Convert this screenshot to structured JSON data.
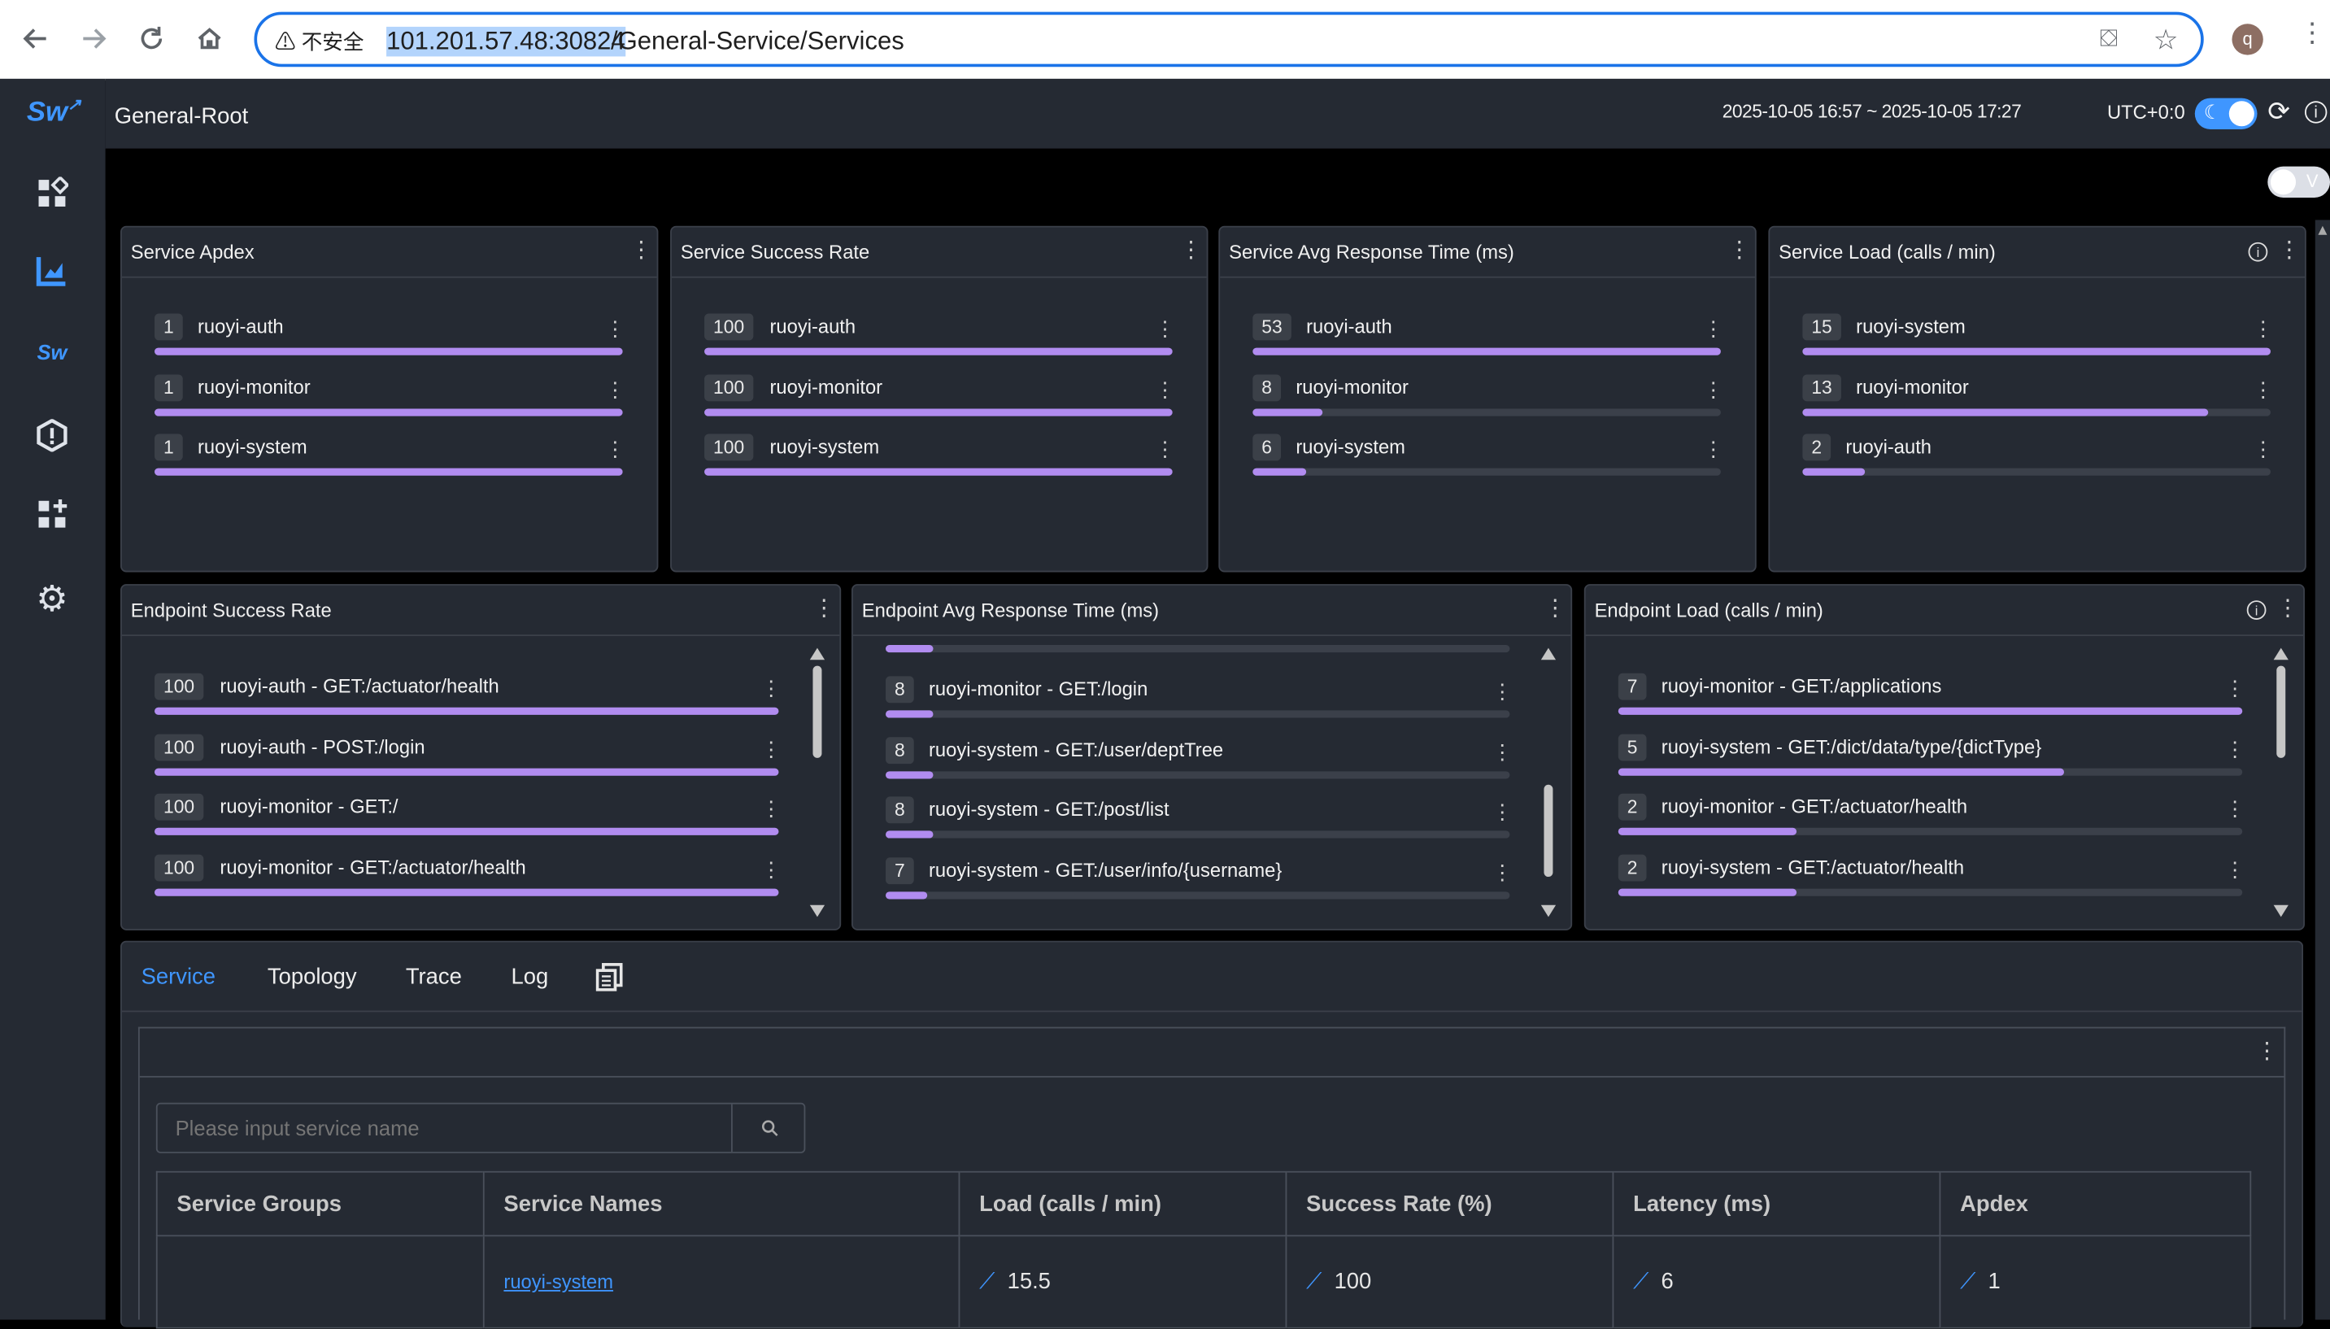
{
  "browser": {
    "insecure_label": "不安全",
    "url_host": "101.201.57.48:30824",
    "url_path": "/General-Service/Services",
    "profile_initial": "q"
  },
  "header": {
    "title": "General-Root",
    "time_range": "2025-10-05 16:57 ~ 2025-10-05 17:27",
    "timezone": "UTC+0:0",
    "toggle_v": "V"
  },
  "service_panels": [
    {
      "title": "Service Apdex",
      "rows": [
        {
          "value": "1",
          "label": "ruoyi-auth",
          "ratio": 1.0
        },
        {
          "value": "1",
          "label": "ruoyi-monitor",
          "ratio": 1.0
        },
        {
          "value": "1",
          "label": "ruoyi-system",
          "ratio": 1.0
        }
      ]
    },
    {
      "title": "Service Success Rate",
      "rows": [
        {
          "value": "100",
          "label": "ruoyi-auth",
          "ratio": 1.0
        },
        {
          "value": "100",
          "label": "ruoyi-monitor",
          "ratio": 1.0
        },
        {
          "value": "100",
          "label": "ruoyi-system",
          "ratio": 1.0
        }
      ]
    },
    {
      "title": "Service Avg Response Time (ms)",
      "rows": [
        {
          "value": "53",
          "label": "ruoyi-auth",
          "ratio": 1.0
        },
        {
          "value": "8",
          "label": "ruoyi-monitor",
          "ratio": 0.15
        },
        {
          "value": "6",
          "label": "ruoyi-system",
          "ratio": 0.113
        }
      ]
    },
    {
      "title": "Service Load (calls / min)",
      "info": true,
      "rows": [
        {
          "value": "15",
          "label": "ruoyi-system",
          "ratio": 1.0
        },
        {
          "value": "13",
          "label": "ruoyi-monitor",
          "ratio": 0.867
        },
        {
          "value": "2",
          "label": "ruoyi-auth",
          "ratio": 0.133
        }
      ]
    }
  ],
  "endpoint_panels": [
    {
      "title": "Endpoint Success Rate",
      "rows": [
        {
          "value": "100",
          "label": "ruoyi-auth - GET:/actuator/health",
          "ratio": 1.0
        },
        {
          "value": "100",
          "label": "ruoyi-auth - POST:/login",
          "ratio": 1.0
        },
        {
          "value": "100",
          "label": "ruoyi-monitor - GET:/",
          "ratio": 1.0
        },
        {
          "value": "100",
          "label": "ruoyi-monitor - GET:/actuator/health",
          "ratio": 1.0
        }
      ]
    },
    {
      "title": "Endpoint Avg Response Time (ms)",
      "rows": [
        {
          "value": "8",
          "label": "ruoyi-monitor - GET:/login",
          "ratio": 0.075
        },
        {
          "value": "8",
          "label": "ruoyi-system - GET:/user/deptTree",
          "ratio": 0.075
        },
        {
          "value": "8",
          "label": "ruoyi-system - GET:/post/list",
          "ratio": 0.075
        },
        {
          "value": "7",
          "label": "ruoyi-system - GET:/user/info/{username}",
          "ratio": 0.066
        }
      ]
    },
    {
      "title": "Endpoint Load (calls / min)",
      "info": true,
      "rows": [
        {
          "value": "7",
          "label": "ruoyi-monitor - GET:/applications",
          "ratio": 1.0
        },
        {
          "value": "5",
          "label": "ruoyi-system - GET:/dict/data/type/{dictType}",
          "ratio": 0.714
        },
        {
          "value": "2",
          "label": "ruoyi-monitor - GET:/actuator/health",
          "ratio": 0.286
        },
        {
          "value": "2",
          "label": "ruoyi-system - GET:/actuator/health",
          "ratio": 0.286
        }
      ]
    }
  ],
  "tabs": [
    "Service",
    "Topology",
    "Trace",
    "Log"
  ],
  "active_tab": "Service",
  "search": {
    "placeholder": "Please input service name"
  },
  "table": {
    "headers": [
      "Service Groups",
      "Service Names",
      "Load (calls / min)",
      "Success Rate (%)",
      "Latency (ms)",
      "Apdex"
    ],
    "rows": [
      {
        "group": "",
        "name": "ruoyi-system",
        "load": "15.5",
        "success": "100",
        "latency": "6",
        "apdex": "1"
      }
    ]
  },
  "colors": {
    "accent": "#3f96ff",
    "bar": "#b18cf0",
    "panel": "#252a33"
  }
}
